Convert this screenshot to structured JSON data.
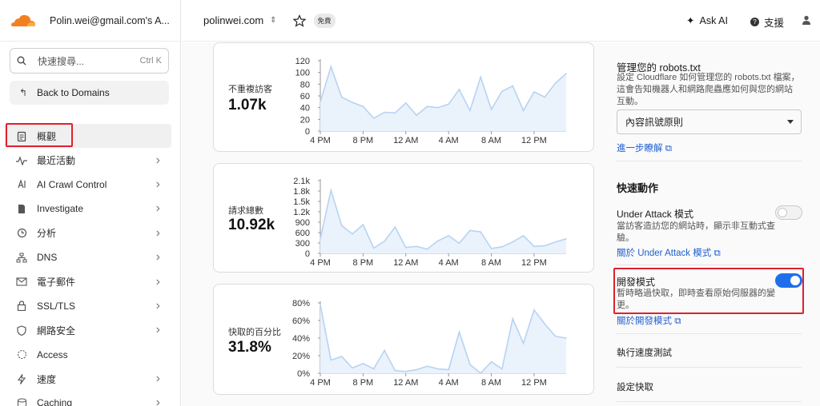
{
  "colors": {
    "accent": "#1f6feb",
    "highlight": "#e0202e",
    "brand": "#f38020",
    "chart_line": "#b7d3f2",
    "chart_fill": "#eaf2fc"
  },
  "sidebar": {
    "account": "Polin.wei@gmail.com's A...",
    "search_placeholder": "快速搜尋...",
    "search_shortcut": "Ctrl K",
    "back_label": "Back to Domains",
    "items": [
      {
        "label": "概觀",
        "icon": "clipboard-icon",
        "chevron": false,
        "active": true
      },
      {
        "label": "最近活動",
        "icon": "pulse-icon",
        "chevron": true
      },
      {
        "label": "AI Crawl Control",
        "icon": "ai-icon",
        "chevron": true
      },
      {
        "label": "Investigate",
        "icon": "document-search-icon",
        "chevron": true
      },
      {
        "label": "分析",
        "icon": "clock-icon",
        "chevron": true
      },
      {
        "label": "DNS",
        "icon": "network-icon",
        "chevron": true
      },
      {
        "label": "電子郵件",
        "icon": "mail-icon",
        "chevron": true
      },
      {
        "label": "SSL/TLS",
        "icon": "lock-icon",
        "chevron": true
      },
      {
        "label": "網路安全",
        "icon": "shield-icon",
        "chevron": true
      },
      {
        "label": "Access",
        "icon": "access-icon",
        "chevron": false
      },
      {
        "label": "速度",
        "icon": "bolt-icon",
        "chevron": true
      },
      {
        "label": "Caching",
        "icon": "cache-icon",
        "chevron": true
      }
    ]
  },
  "topbar": {
    "domain": "polinwei.com",
    "plan_badge": "免費",
    "ask_ai": "Ask AI",
    "support": "支援"
  },
  "metrics": [
    {
      "label": "不重複訪客",
      "value": "1.07k"
    },
    {
      "label": "請求總數",
      "value": "10.92k"
    },
    {
      "label": "快取的百分比",
      "value": "31.8%"
    }
  ],
  "chart_data": [
    {
      "type": "area",
      "title": "不重複訪客",
      "x": [
        "4 PM",
        "",
        "",
        "",
        "8 PM",
        "",
        "",
        "",
        "12 AM",
        "",
        "",
        "",
        "4 AM",
        "",
        "",
        "",
        "8 AM",
        "",
        "",
        "",
        "12 PM",
        "",
        "",
        ""
      ],
      "x_ticks": [
        "4 PM",
        "8 PM",
        "12 AM",
        "4 AM",
        "8 AM",
        "12 PM"
      ],
      "y_ticks": [
        "0",
        "20",
        "40",
        "60",
        "80",
        "100",
        "120"
      ],
      "ylim": [
        0,
        120
      ],
      "values": [
        50,
        110,
        58,
        49,
        42,
        22,
        32,
        31,
        48,
        27,
        42,
        40,
        46,
        71,
        35,
        92,
        37,
        68,
        77,
        35,
        67,
        58,
        82,
        98
      ],
      "grid": false
    },
    {
      "type": "area",
      "title": "請求總數",
      "x_ticks": [
        "4 PM",
        "8 PM",
        "12 AM",
        "4 AM",
        "8 AM",
        "12 PM"
      ],
      "y_ticks": [
        "0",
        "300",
        "600",
        "900",
        "1.2k",
        "1.5k",
        "1.8k",
        "2.1k"
      ],
      "ylim": [
        0,
        2100
      ],
      "values": [
        420,
        1820,
        800,
        560,
        830,
        150,
        350,
        760,
        170,
        200,
        120,
        360,
        510,
        290,
        660,
        620,
        140,
        190,
        330,
        510,
        200,
        220,
        330,
        420
      ],
      "grid": false
    },
    {
      "type": "area",
      "title": "快取的百分比",
      "x_ticks": [
        "4 PM",
        "8 PM",
        "12 AM",
        "4 AM",
        "8 AM",
        "12 PM"
      ],
      "y_ticks": [
        "0%",
        "20%",
        "40%",
        "60%",
        "80%"
      ],
      "ylim": [
        0,
        80
      ],
      "values": [
        78,
        15,
        19,
        6,
        11,
        5,
        26,
        3,
        2,
        4,
        8,
        5,
        4,
        47,
        10,
        0,
        13,
        5,
        62,
        34,
        72,
        56,
        42,
        40
      ],
      "grid": false
    }
  ],
  "right_panel": {
    "robots_title": "管理您的 robots.txt",
    "robots_desc": "設定 Cloudflare 如何管理您的 robots.txt 檔案，這會告知機器人和網路爬蟲應如何與您的網站互動。",
    "robots_select": "內容訊號原則",
    "robots_link": "進一步瞭解",
    "quick_actions": "快速動作",
    "under_attack_title": "Under Attack 模式",
    "under_attack_desc": "當訪客造訪您的網站時，顯示非互動式查驗。",
    "under_attack_link": "關於 Under Attack 模式",
    "under_attack_on": false,
    "dev_mode_title": "開發模式",
    "dev_mode_desc": "暫時略過快取，即時查看原始伺服器的變更。",
    "dev_mode_link": "關於開發模式",
    "dev_mode_on": true,
    "speed_test": "執行速度測試",
    "cache_settings": "設定快取"
  }
}
